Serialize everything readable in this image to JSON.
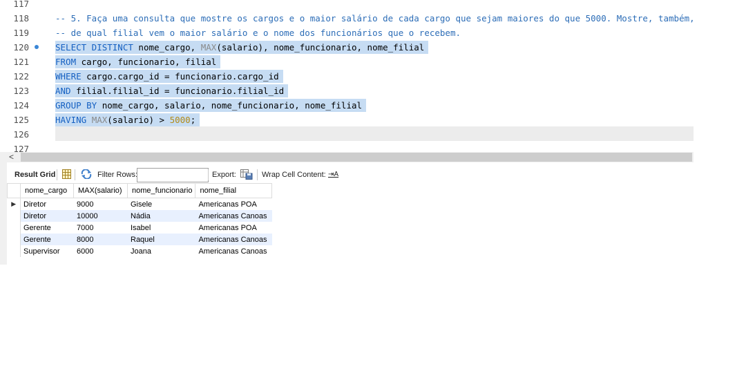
{
  "editor": {
    "lines": [
      {
        "num": "117",
        "parts": [
          {
            "t": "",
            "c": "cm"
          }
        ]
      },
      {
        "num": "118",
        "parts": [
          {
            "t": "-- 5. Faça uma consulta que mostre os cargos e o maior salário de cada cargo que sejam maiores do que 5000. Mostre, também,",
            "c": "cm"
          }
        ]
      },
      {
        "num": "119",
        "parts": [
          {
            "t": "-- de qual filial vem o maior salário e o nome dos funcionários que o recebem.",
            "c": "cm"
          }
        ]
      },
      {
        "num": "120",
        "parts": [
          {
            "t": "SELECT DISTINCT",
            "c": "kw"
          },
          {
            "t": " nome_cargo, ",
            "c": ""
          },
          {
            "t": "MAX",
            "c": "fn"
          },
          {
            "t": "(salario), nome_funcionario, nome_filial",
            "c": ""
          }
        ]
      },
      {
        "num": "121",
        "parts": [
          {
            "t": "FROM",
            "c": "kw"
          },
          {
            "t": " cargo, funcionario, filial",
            "c": ""
          }
        ]
      },
      {
        "num": "122",
        "parts": [
          {
            "t": "WHERE",
            "c": "kw"
          },
          {
            "t": " cargo.cargo_id = funcionario.cargo_id",
            "c": ""
          }
        ]
      },
      {
        "num": "123",
        "parts": [
          {
            "t": "AND",
            "c": "kw"
          },
          {
            "t": " filial.filial_id = funcionario.filial_id",
            "c": ""
          }
        ]
      },
      {
        "num": "124",
        "parts": [
          {
            "t": "GROUP BY",
            "c": "kw"
          },
          {
            "t": " nome_cargo, salario, nome_funcionario, nome_filial",
            "c": ""
          }
        ]
      },
      {
        "num": "125",
        "parts": [
          {
            "t": "HAVING",
            "c": "kw"
          },
          {
            "t": " ",
            "c": ""
          },
          {
            "t": "MAX",
            "c": "fn"
          },
          {
            "t": "(salario) > ",
            "c": ""
          },
          {
            "t": "5000",
            "c": "num"
          },
          {
            "t": ";",
            "c": ""
          }
        ]
      },
      {
        "num": "126",
        "parts": [
          {
            "t": "",
            "c": ""
          }
        ]
      },
      {
        "num": "127",
        "parts": [
          {
            "t": "",
            "c": ""
          }
        ]
      }
    ]
  },
  "toolbar": {
    "result_grid": "Result Grid",
    "filter_rows": "Filter Rows:",
    "filter_value": "",
    "export": "Export:",
    "wrap_cell": "Wrap Cell Content:",
    "wrap_icon_glyph": "⇥A"
  },
  "grid": {
    "columns": [
      "nome_cargo",
      "MAX(salario)",
      "nome_funcionario",
      "nome_filial"
    ],
    "rows": [
      [
        "Diretor",
        "9000",
        "Gisele",
        "Americanas POA"
      ],
      [
        "Diretor",
        "10000",
        "Nádia",
        "Americanas Canoas"
      ],
      [
        "Gerente",
        "7000",
        "Isabel",
        "Americanas POA"
      ],
      [
        "Gerente",
        "8000",
        "Raquel",
        "Americanas Canoas"
      ],
      [
        "Supervisor",
        "6000",
        "Joana",
        "Americanas Canoas"
      ]
    ],
    "current_row_marker": "▶"
  },
  "colors": {
    "keyword": "#1560c2",
    "comment": "#2c6db7",
    "selection": "#c6dcf3",
    "number": "#b28a16",
    "alt_row": "#e8f0fe"
  },
  "icons": [
    "grid-view-icon",
    "refresh-icon",
    "export-icon",
    "wrap-text-icon",
    "breakpoint-dot-icon",
    "scroll-left-arrow-icon",
    "current-row-arrow-icon"
  ]
}
